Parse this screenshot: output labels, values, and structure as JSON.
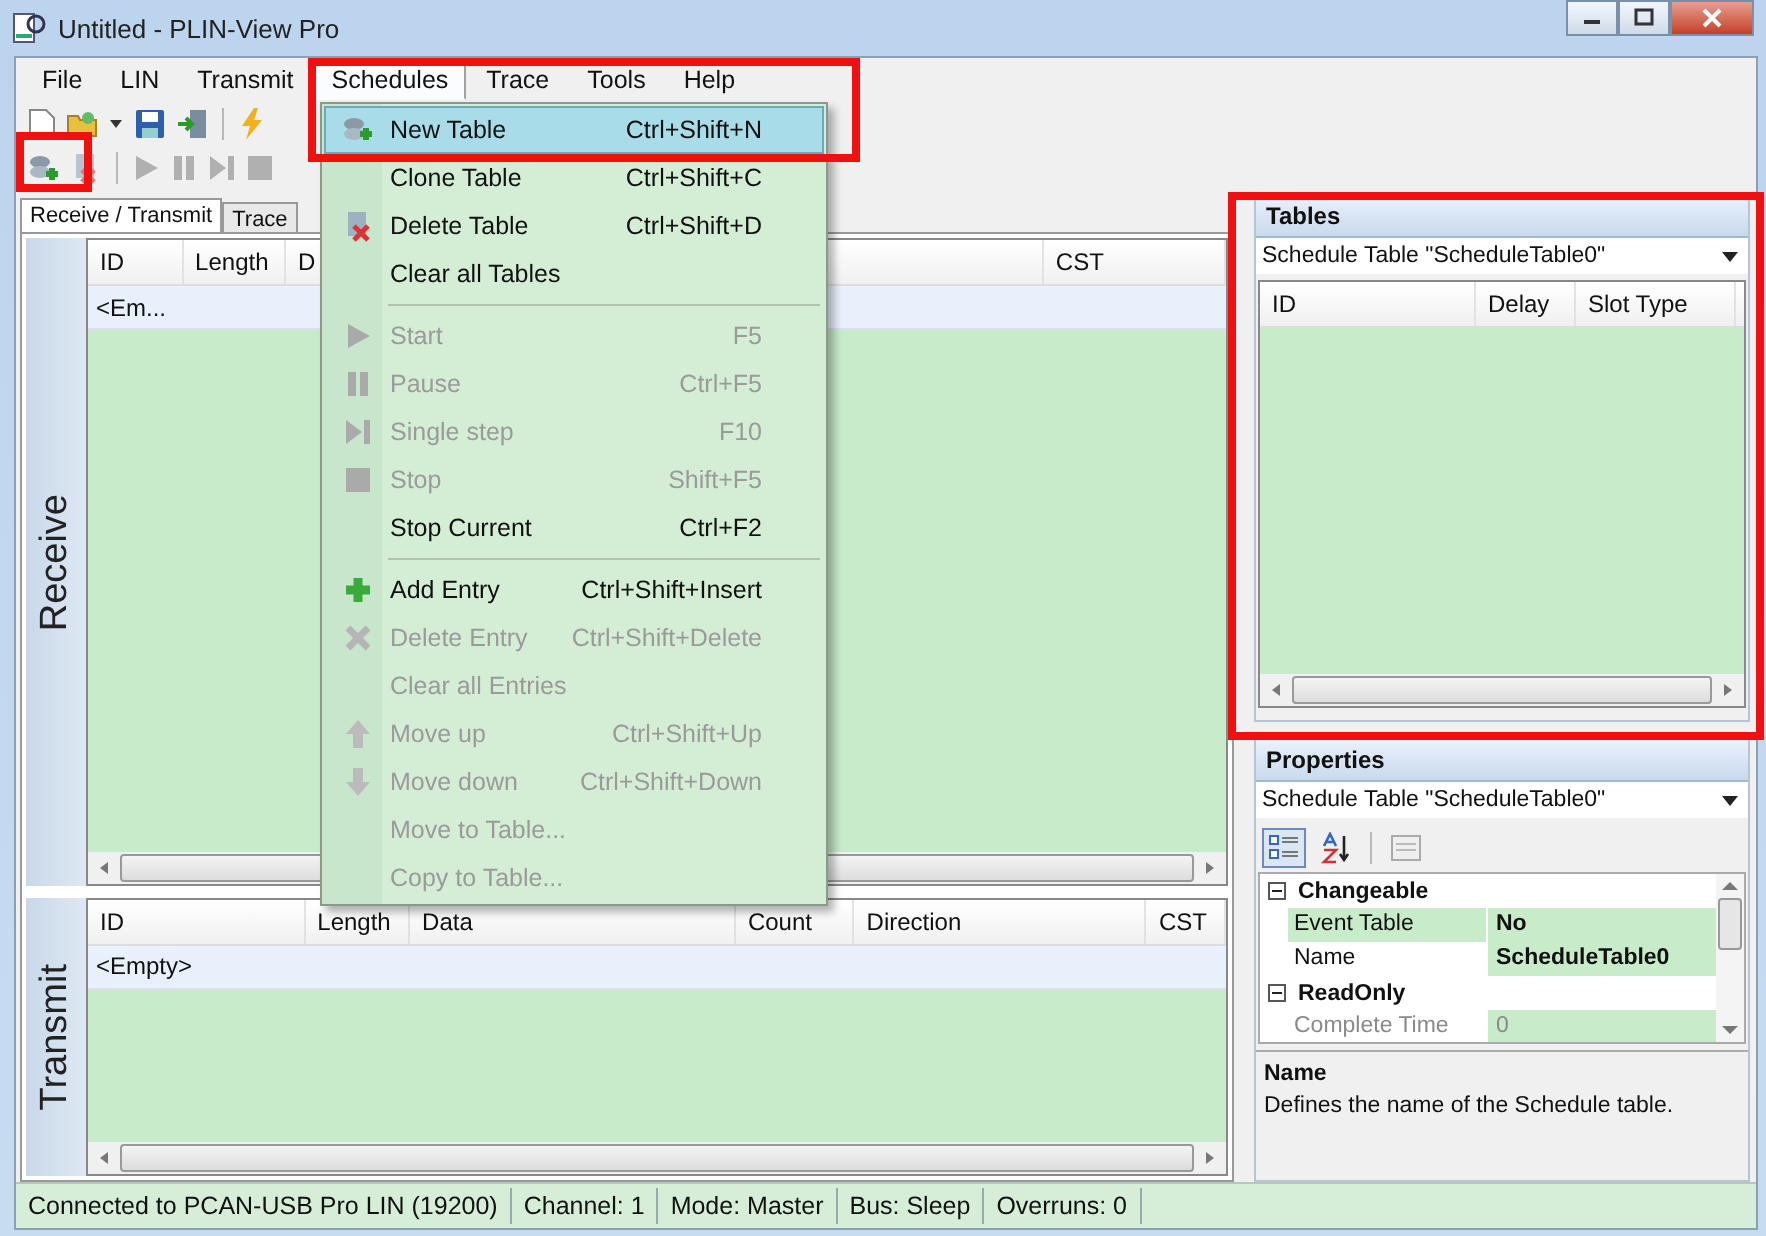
{
  "window": {
    "title": "Untitled - PLIN-View Pro"
  },
  "menu_bar": [
    {
      "label": "File",
      "selected": false
    },
    {
      "label": "LIN",
      "selected": false
    },
    {
      "label": "Transmit",
      "selected": false
    },
    {
      "label": "Schedules",
      "selected": true
    },
    {
      "label": "Trace",
      "selected": false
    },
    {
      "label": "Tools",
      "selected": false
    },
    {
      "label": "Help",
      "selected": false
    }
  ],
  "schedules_menu": [
    {
      "kind": "item",
      "label": "New Table",
      "shortcut": "Ctrl+Shift+N",
      "disabled": false,
      "selected": true
    },
    {
      "kind": "item",
      "label": "Clone Table",
      "shortcut": "Ctrl+Shift+C",
      "disabled": false,
      "selected": false
    },
    {
      "kind": "item",
      "label": "Delete Table",
      "shortcut": "Ctrl+Shift+D",
      "disabled": false,
      "selected": false
    },
    {
      "kind": "item",
      "label": "Clear all Tables",
      "disabled": false,
      "selected": false
    },
    {
      "kind": "separator"
    },
    {
      "kind": "item",
      "label": "Start",
      "shortcut": "F5",
      "disabled": true,
      "selected": false
    },
    {
      "kind": "item",
      "label": "Pause",
      "shortcut": "Ctrl+F5",
      "disabled": true,
      "selected": false
    },
    {
      "kind": "item",
      "label": "Single step",
      "shortcut": "F10",
      "disabled": true,
      "selected": false
    },
    {
      "kind": "item",
      "label": "Stop",
      "shortcut": "Shift+F5",
      "disabled": true,
      "selected": false
    },
    {
      "kind": "item",
      "label": "Stop Current",
      "shortcut": "Ctrl+F2",
      "disabled": false,
      "selected": false
    },
    {
      "kind": "separator"
    },
    {
      "kind": "item",
      "label": "Add Entry",
      "shortcut": "Ctrl+Shift+Insert",
      "disabled": false,
      "selected": false
    },
    {
      "kind": "item",
      "label": "Delete Entry",
      "shortcut": "Ctrl+Shift+Delete",
      "disabled": true,
      "selected": false
    },
    {
      "kind": "item",
      "label": "Clear all Entries",
      "disabled": true,
      "selected": false
    },
    {
      "kind": "item",
      "label": "Move up",
      "shortcut": "Ctrl+Shift+Up",
      "disabled": true,
      "selected": false
    },
    {
      "kind": "item",
      "label": "Move down",
      "shortcut": "Ctrl+Shift+Down",
      "disabled": true,
      "selected": false
    },
    {
      "kind": "item",
      "label": "Move to Table...",
      "disabled": true,
      "selected": false
    },
    {
      "kind": "item",
      "label": "Copy to Table...",
      "disabled": true,
      "selected": false
    }
  ],
  "tabs": [
    {
      "label": "Receive / Transmit",
      "selected": true
    },
    {
      "label": "Trace",
      "selected": false
    }
  ],
  "receive": {
    "title": "Receive",
    "columns": [
      "ID",
      "Length",
      "D",
      "CST"
    ],
    "rows": [
      [
        "<Em..."
      ]
    ]
  },
  "transmit": {
    "title": "Transmit",
    "columns": [
      "ID",
      "Length",
      "Data",
      "Count",
      "Direction",
      "CST"
    ],
    "rows": [
      [
        "<Empty>"
      ]
    ]
  },
  "tables_panel": {
    "title": "Tables",
    "selector": "Schedule Table \"ScheduleTable0\"",
    "columns": [
      "ID",
      "Delay",
      "Slot Type"
    ]
  },
  "properties_panel": {
    "title": "Properties",
    "selector": "Schedule Table \"ScheduleTable0\"",
    "groups": [
      {
        "label": "Changeable",
        "expanded": true,
        "items": [
          {
            "name": "Event Table",
            "value": "No",
            "disabled": false
          },
          {
            "name": "Name",
            "value": "ScheduleTable0",
            "disabled": false
          }
        ]
      },
      {
        "label": "ReadOnly",
        "expanded": true,
        "items": [
          {
            "name": "Complete Time",
            "value": "0",
            "disabled": true
          }
        ]
      }
    ],
    "description": {
      "title": "Name",
      "text": "Defines the name of the Schedule table."
    }
  },
  "status_bar": [
    "Connected to PCAN-USB Pro LIN (19200)",
    "Channel: 1",
    "Mode: Master",
    "Bus: Sleep",
    "Overruns: 0"
  ]
}
